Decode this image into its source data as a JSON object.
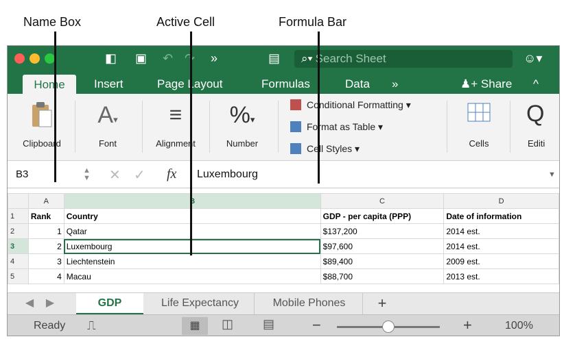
{
  "annotations": {
    "name_box": "Name Box",
    "active_cell": "Active Cell",
    "formula_bar": "Formula Bar"
  },
  "toolbar": {
    "search_placeholder": "Search Sheet",
    "overflow": "»",
    "smiley": "☺▾"
  },
  "ribbon_tabs": {
    "home": "Home",
    "insert": "Insert",
    "page_layout": "Page Layout",
    "formulas": "Formulas",
    "data": "Data",
    "more": "»",
    "share": "Share",
    "collapse": "^"
  },
  "ribbon": {
    "clipboard": "Clipboard",
    "font": "Font",
    "alignment": "Alignment",
    "number": "Number",
    "conditional_formatting": "Conditional Formatting ▾",
    "format_as_table": "Format as Table ▾",
    "cell_styles": "Cell Styles ▾",
    "cells": "Cells",
    "editing": "Editi"
  },
  "formula_bar": {
    "name_box": "B3",
    "fx": "fx",
    "value": "Luxembourg"
  },
  "sheet": {
    "columns": [
      "A",
      "B",
      "C",
      "D"
    ],
    "rows": [
      {
        "num": "1",
        "a": "Rank",
        "b": "Country",
        "c": "GDP - per capita (PPP)",
        "d": "Date of information"
      },
      {
        "num": "2",
        "a": "1",
        "b": "Qatar",
        "c": "$137,200",
        "d": "2014 est."
      },
      {
        "num": "3",
        "a": "2",
        "b": "Luxembourg",
        "c": "$97,600",
        "d": "2014 est."
      },
      {
        "num": "4",
        "a": "3",
        "b": "Liechtenstein",
        "c": "$89,400",
        "d": "2009 est."
      },
      {
        "num": "5",
        "a": "4",
        "b": "Macau",
        "c": "$88,700",
        "d": "2013 est."
      }
    ]
  },
  "sheet_tabs": {
    "gdp": "GDP",
    "life_expectancy": "Life Expectancy",
    "mobile_phones": "Mobile Phones",
    "add": "+"
  },
  "status": {
    "ready": "Ready",
    "zoom": "100%",
    "zoom_fraction": 0.5
  },
  "colors": {
    "accent": "#227447"
  }
}
